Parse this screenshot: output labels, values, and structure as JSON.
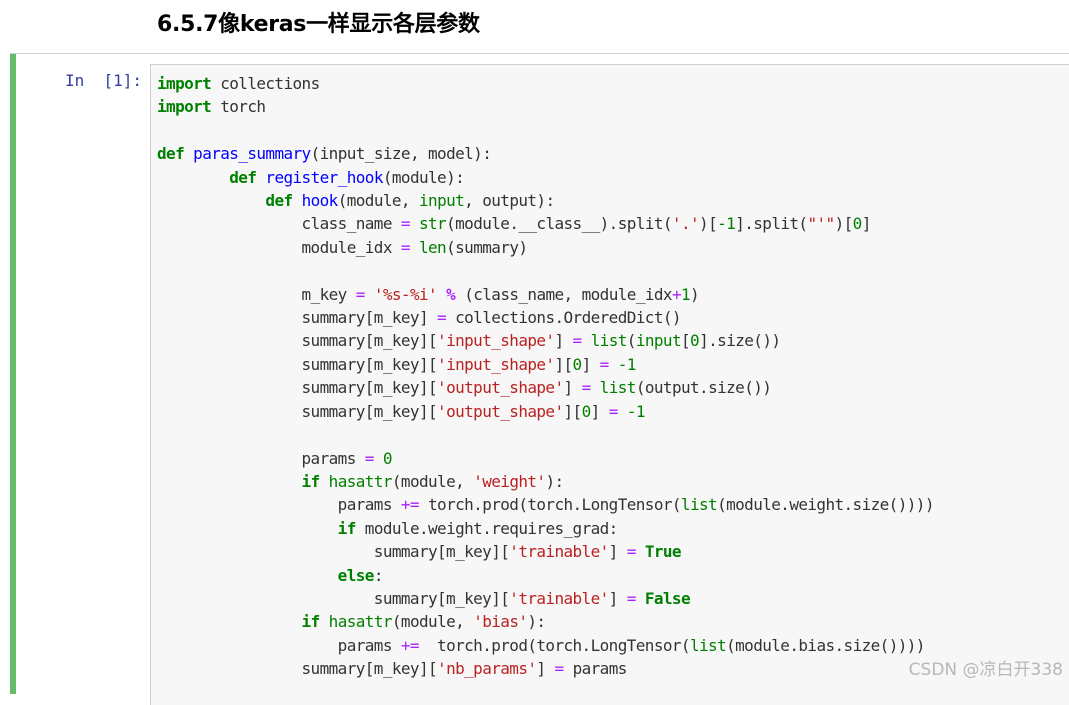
{
  "heading": "6.5.7像keras一样显示各层参数",
  "cell": {
    "prompt": "In  [1]:",
    "code_lines": [
      [
        {
          "t": "import",
          "c": "kw"
        },
        {
          "t": " collections",
          "c": ""
        }
      ],
      [
        {
          "t": "import",
          "c": "kw"
        },
        {
          "t": " torch",
          "c": ""
        }
      ],
      [],
      [
        {
          "t": "def",
          "c": "kw"
        },
        {
          "t": " ",
          "c": ""
        },
        {
          "t": "paras_summary",
          "c": "fn"
        },
        {
          "t": "(input_size, model):",
          "c": ""
        }
      ],
      [
        {
          "t": "        ",
          "c": ""
        },
        {
          "t": "def",
          "c": "kw"
        },
        {
          "t": " ",
          "c": ""
        },
        {
          "t": "register_hook",
          "c": "fn"
        },
        {
          "t": "(module):",
          "c": ""
        }
      ],
      [
        {
          "t": "            ",
          "c": ""
        },
        {
          "t": "def",
          "c": "kw"
        },
        {
          "t": " ",
          "c": ""
        },
        {
          "t": "hook",
          "c": "fn"
        },
        {
          "t": "(module, ",
          "c": ""
        },
        {
          "t": "input",
          "c": "bi"
        },
        {
          "t": ", output):",
          "c": ""
        }
      ],
      [
        {
          "t": "                class_name ",
          "c": ""
        },
        {
          "t": "=",
          "c": "op"
        },
        {
          "t": " ",
          "c": ""
        },
        {
          "t": "str",
          "c": "bi"
        },
        {
          "t": "(module.__class__).split(",
          "c": ""
        },
        {
          "t": "'.'",
          "c": "st"
        },
        {
          "t": ")[",
          "c": ""
        },
        {
          "t": "-1",
          "c": "nm"
        },
        {
          "t": "].split(",
          "c": ""
        },
        {
          "t": "\"'\"",
          "c": "st"
        },
        {
          "t": ")[",
          "c": ""
        },
        {
          "t": "0",
          "c": "nm"
        },
        {
          "t": "]",
          "c": ""
        }
      ],
      [
        {
          "t": "                module_idx ",
          "c": ""
        },
        {
          "t": "=",
          "c": "op"
        },
        {
          "t": " ",
          "c": ""
        },
        {
          "t": "len",
          "c": "bi"
        },
        {
          "t": "(summary)",
          "c": ""
        }
      ],
      [],
      [
        {
          "t": "                m_key ",
          "c": ""
        },
        {
          "t": "=",
          "c": "op"
        },
        {
          "t": " ",
          "c": ""
        },
        {
          "t": "'%s-%i'",
          "c": "st"
        },
        {
          "t": " ",
          "c": ""
        },
        {
          "t": "%",
          "c": "opb"
        },
        {
          "t": " (class_name, module_idx",
          "c": ""
        },
        {
          "t": "+",
          "c": "op"
        },
        {
          "t": "1",
          "c": "nm"
        },
        {
          "t": ")",
          "c": ""
        }
      ],
      [
        {
          "t": "                summary[m_key] ",
          "c": ""
        },
        {
          "t": "=",
          "c": "op"
        },
        {
          "t": " collections.OrderedDict()",
          "c": ""
        }
      ],
      [
        {
          "t": "                summary[m_key][",
          "c": ""
        },
        {
          "t": "'input_shape'",
          "c": "st"
        },
        {
          "t": "] ",
          "c": ""
        },
        {
          "t": "=",
          "c": "op"
        },
        {
          "t": " ",
          "c": ""
        },
        {
          "t": "list",
          "c": "bi"
        },
        {
          "t": "(",
          "c": ""
        },
        {
          "t": "input",
          "c": "bi"
        },
        {
          "t": "[",
          "c": ""
        },
        {
          "t": "0",
          "c": "nm"
        },
        {
          "t": "].size())",
          "c": ""
        }
      ],
      [
        {
          "t": "                summary[m_key][",
          "c": ""
        },
        {
          "t": "'input_shape'",
          "c": "st"
        },
        {
          "t": "][",
          "c": ""
        },
        {
          "t": "0",
          "c": "nm"
        },
        {
          "t": "] ",
          "c": ""
        },
        {
          "t": "=",
          "c": "op"
        },
        {
          "t": " ",
          "c": ""
        },
        {
          "t": "-1",
          "c": "nm"
        }
      ],
      [
        {
          "t": "                summary[m_key][",
          "c": ""
        },
        {
          "t": "'output_shape'",
          "c": "st"
        },
        {
          "t": "] ",
          "c": ""
        },
        {
          "t": "=",
          "c": "op"
        },
        {
          "t": " ",
          "c": ""
        },
        {
          "t": "list",
          "c": "bi"
        },
        {
          "t": "(output.size())",
          "c": ""
        }
      ],
      [
        {
          "t": "                summary[m_key][",
          "c": ""
        },
        {
          "t": "'output_shape'",
          "c": "st"
        },
        {
          "t": "][",
          "c": ""
        },
        {
          "t": "0",
          "c": "nm"
        },
        {
          "t": "] ",
          "c": ""
        },
        {
          "t": "=",
          "c": "op"
        },
        {
          "t": " ",
          "c": ""
        },
        {
          "t": "-1",
          "c": "nm"
        }
      ],
      [],
      [
        {
          "t": "                params ",
          "c": ""
        },
        {
          "t": "=",
          "c": "op"
        },
        {
          "t": " ",
          "c": ""
        },
        {
          "t": "0",
          "c": "nm"
        }
      ],
      [
        {
          "t": "                ",
          "c": ""
        },
        {
          "t": "if",
          "c": "kw"
        },
        {
          "t": " ",
          "c": ""
        },
        {
          "t": "hasattr",
          "c": "bi"
        },
        {
          "t": "(module, ",
          "c": ""
        },
        {
          "t": "'weight'",
          "c": "st"
        },
        {
          "t": "):",
          "c": ""
        }
      ],
      [
        {
          "t": "                    params ",
          "c": ""
        },
        {
          "t": "+=",
          "c": "op"
        },
        {
          "t": " torch.prod(torch.LongTensor(",
          "c": ""
        },
        {
          "t": "list",
          "c": "bi"
        },
        {
          "t": "(module.weight.size())))",
          "c": ""
        }
      ],
      [
        {
          "t": "                    ",
          "c": ""
        },
        {
          "t": "if",
          "c": "kw"
        },
        {
          "t": " module.weight.requires_grad:",
          "c": ""
        }
      ],
      [
        {
          "t": "                        summary[m_key][",
          "c": ""
        },
        {
          "t": "'trainable'",
          "c": "st"
        },
        {
          "t": "] ",
          "c": ""
        },
        {
          "t": "=",
          "c": "op"
        },
        {
          "t": " ",
          "c": ""
        },
        {
          "t": "True",
          "c": "kw"
        }
      ],
      [
        {
          "t": "                    ",
          "c": ""
        },
        {
          "t": "else",
          "c": "kw"
        },
        {
          "t": ":",
          "c": ""
        }
      ],
      [
        {
          "t": "                        summary[m_key][",
          "c": ""
        },
        {
          "t": "'trainable'",
          "c": "st"
        },
        {
          "t": "] ",
          "c": ""
        },
        {
          "t": "=",
          "c": "op"
        },
        {
          "t": " ",
          "c": ""
        },
        {
          "t": "False",
          "c": "kw"
        }
      ],
      [
        {
          "t": "                ",
          "c": ""
        },
        {
          "t": "if",
          "c": "kw"
        },
        {
          "t": " ",
          "c": ""
        },
        {
          "t": "hasattr",
          "c": "bi"
        },
        {
          "t": "(module, ",
          "c": ""
        },
        {
          "t": "'bias'",
          "c": "st"
        },
        {
          "t": "):",
          "c": ""
        }
      ],
      [
        {
          "t": "                    params ",
          "c": ""
        },
        {
          "t": "+=",
          "c": "op"
        },
        {
          "t": "  torch.prod(torch.LongTensor(",
          "c": ""
        },
        {
          "t": "list",
          "c": "bi"
        },
        {
          "t": "(module.bias.size())))",
          "c": ""
        }
      ],
      [
        {
          "t": "                summary[m_key][",
          "c": ""
        },
        {
          "t": "'nb_params'",
          "c": "st"
        },
        {
          "t": "] ",
          "c": ""
        },
        {
          "t": "=",
          "c": "op"
        },
        {
          "t": " params",
          "c": ""
        }
      ]
    ]
  },
  "watermark": "CSDN @凉白开338",
  "colors": {
    "cell_bar": "#66bb6a",
    "prompt": "#303f9f",
    "keyword": "#008000",
    "function": "#0000ff",
    "string": "#ba2121",
    "operator": "#aa22ff"
  }
}
